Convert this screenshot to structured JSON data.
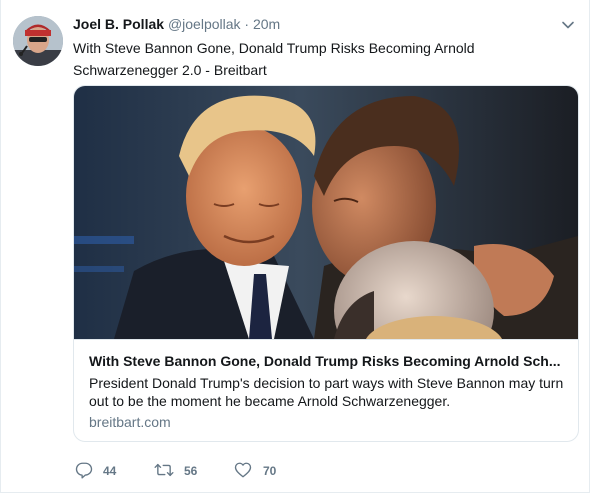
{
  "tweet": {
    "fullname": "Joel B. Pollak",
    "username": "@joelpollak",
    "separator": "·",
    "time": "20m",
    "text": "With Steve Bannon Gone, Donald Trump Risks Becoming Arnold Schwarzenegger 2.0 - Breitbart"
  },
  "card": {
    "title": "With Steve Bannon Gone, Donald Trump Risks Becoming Arnold Sch...",
    "description": "President Donald Trump's decision to part ways with Steve Bannon may turn out to be the moment he became Arnold Schwarzenegger.",
    "domain": "breitbart.com"
  },
  "actions": {
    "replies": "44",
    "retweets": "56",
    "likes": "70"
  },
  "icons": {
    "caret": "chevron-down-icon",
    "reply": "reply-icon",
    "retweet": "retweet-icon",
    "like": "heart-icon"
  },
  "colors": {
    "secondary_text": "#657786",
    "border": "#e1e8ed"
  }
}
